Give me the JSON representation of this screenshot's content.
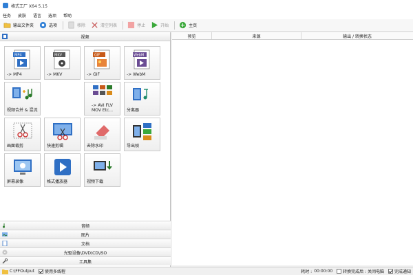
{
  "window": {
    "title": "格式工厂 X64 5.15"
  },
  "menu": [
    "任务",
    "皮肤",
    "语言",
    "选项",
    "帮助"
  ],
  "toolbar": {
    "output_folder": "输出文件夹",
    "options": "选项",
    "remove": "移除",
    "clear_list": "清空列表",
    "stop": "停止",
    "start": "开始",
    "home": "主页"
  },
  "left": {
    "section_title": "视频",
    "tiles": [
      {
        "label": "-> MP4",
        "badge": "MP4",
        "color": "#2f6fc4"
      },
      {
        "label": "-> MKV",
        "badge": "MKV",
        "color": "#555555"
      },
      {
        "label": "-> GIF",
        "badge": "GIF",
        "color": "#c75a1a"
      },
      {
        "label": "-> WebM",
        "badge": "WebM",
        "color": "#6a4c93"
      },
      {
        "label": "视频合并 & 混流",
        "badge": "",
        "color": "#2a7a2a"
      },
      {
        "label": "-> AVI FLV MOV Etc...",
        "badge": "",
        "color": "#2f6fc4"
      },
      {
        "label": "分离器",
        "badge": "",
        "color": "#1c8a6a"
      },
      {
        "label": "画面裁剪",
        "badge": "",
        "color": "#c33"
      },
      {
        "label": "快速剪辑",
        "badge": "",
        "color": "#c33"
      },
      {
        "label": "去除水印",
        "badge": "",
        "color": "#d98b1a"
      },
      {
        "label": "导出帧",
        "badge": "",
        "color": "#2f6fc4"
      },
      {
        "label": "屏幕录像",
        "badge": "",
        "color": "#2f6fc4"
      },
      {
        "label": "格式播放器",
        "badge": "",
        "color": "#2f6fc4"
      },
      {
        "label": "视频下载",
        "badge": "",
        "color": "#2a7a2a"
      }
    ],
    "groups": [
      "音频",
      "图片",
      "文档",
      "光驱设备\\DVD\\CD\\ISO",
      "工具集"
    ]
  },
  "list": {
    "columns": [
      "预览",
      "来源",
      "输出 / 转换状态"
    ]
  },
  "status": {
    "output_path": "C:\\FFOutput",
    "multithread": "使用多线程",
    "elapsed_label": "耗时 :",
    "elapsed_value": "00:00:00",
    "after_convert": "转换完成后 : 关闭电脑",
    "notify": "完成通知"
  },
  "colors": {
    "accent": "#2f7fd6",
    "start_green": "#3aa83a",
    "stop_red": "#e03c3c"
  }
}
